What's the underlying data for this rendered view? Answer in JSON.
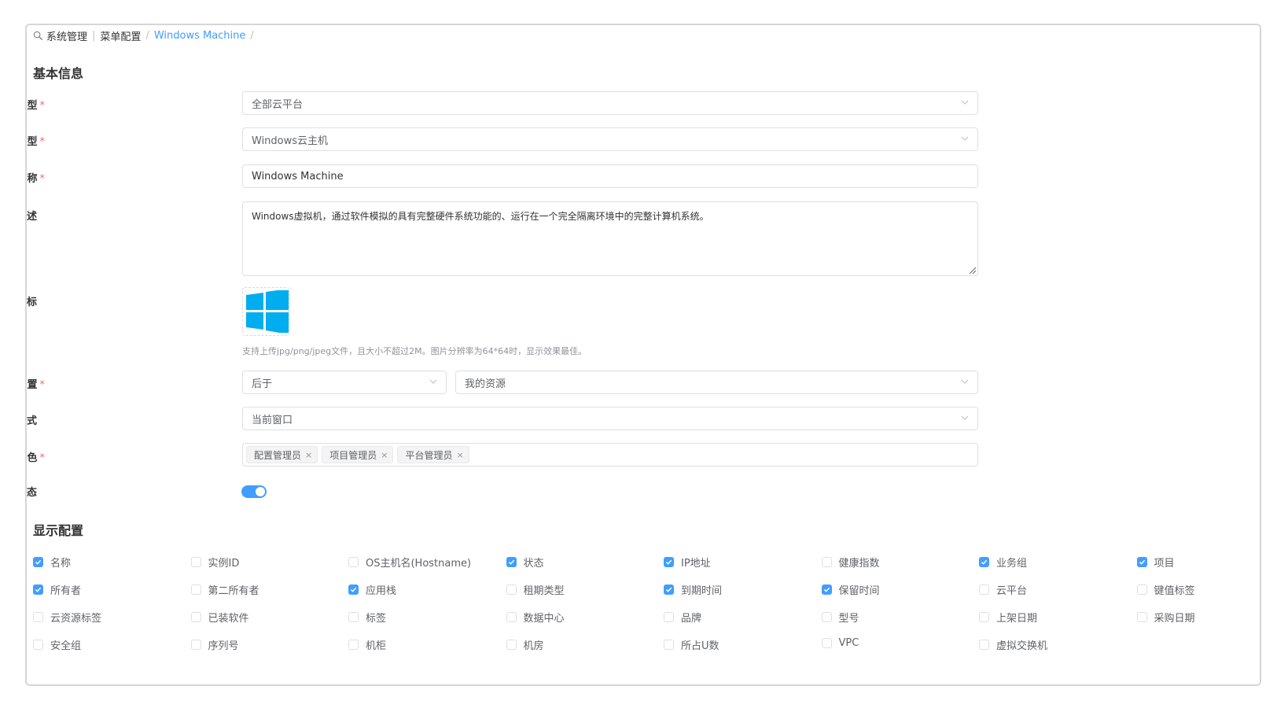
{
  "breadcrumb": {
    "items": [
      "系统管理",
      "菜单配置",
      "Windows Machine"
    ],
    "trailing_sep": "/"
  },
  "sections": {
    "basic_info": "基本信息",
    "display_config": "显示配置"
  },
  "form": {
    "cloud_platform_type": {
      "label": "云平台类型",
      "value": "全部云平台",
      "required": true
    },
    "resource_type": {
      "label": "资源类型",
      "value": "Windows云主机",
      "required": true
    },
    "name": {
      "label": "名称",
      "value": "Windows Machine",
      "required": true
    },
    "description": {
      "label": "描述",
      "value": "Windows虚拟机，通过软件模拟的具有完整硬件系统功能的、运行在一个完全隔离环境中的完整计算机系统。"
    },
    "icon": {
      "label": "图标",
      "icon": "windows-logo",
      "hint": "支持上传jpg/png/jpeg文件，且大小不超过2M。图片分辨率为64*64时，显示效果最佳。"
    },
    "position": {
      "label": "位置",
      "required": true,
      "relation": "后于",
      "target": "我的资源"
    },
    "open_mode": {
      "label": "打开方式",
      "value": "当前窗口"
    },
    "roles": {
      "label": "角色",
      "required": true,
      "tags": [
        "配置管理员",
        "项目管理员",
        "平台管理员"
      ],
      "tag_close": "×"
    },
    "enabled": {
      "label": "启用状态",
      "on": true
    }
  },
  "display_columns": [
    [
      "名称",
      true
    ],
    [
      "实例ID",
      false
    ],
    [
      "OS主机名(Hostname)",
      false
    ],
    [
      "状态",
      true
    ],
    [
      "IP地址",
      true
    ],
    [
      "健康指数",
      false
    ],
    [
      "业务组",
      true
    ],
    [
      "项目",
      true
    ],
    [
      "所有者",
      true
    ],
    [
      "第二所有者",
      false
    ],
    [
      "应用栈",
      true
    ],
    [
      "租期类型",
      false
    ],
    [
      "到期时间",
      true
    ],
    [
      "保留时间",
      true
    ],
    [
      "云平台",
      false
    ],
    [
      "键值标签",
      false
    ],
    [
      "云资源标签",
      false
    ],
    [
      "已装软件",
      false
    ],
    [
      "标签",
      false
    ],
    [
      "数据中心",
      false
    ],
    [
      "品牌",
      false
    ],
    [
      "型号",
      false
    ],
    [
      "上架日期",
      false
    ],
    [
      "采购日期",
      false
    ],
    [
      "安全组",
      false
    ],
    [
      "序列号",
      false
    ],
    [
      "机柜",
      false
    ],
    [
      "机房",
      false
    ],
    [
      "所占U数",
      false
    ],
    [
      "VPC",
      false
    ],
    [
      "虚拟交换机",
      false
    ]
  ],
  "colors": {
    "accent": "#409eff",
    "required": "#f56c6c",
    "windows_blue": "#00adef"
  }
}
